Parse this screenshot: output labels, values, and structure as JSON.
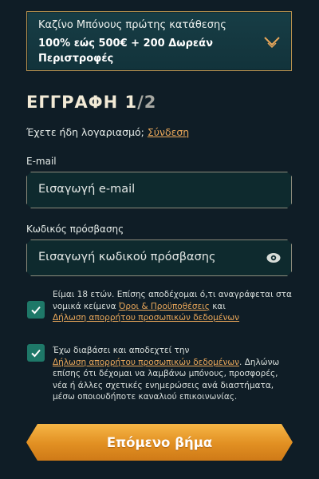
{
  "bonus": {
    "subtitle": "Καζίνο Μπόνους πρώτης κατάθεσης",
    "offer": "100% εώς 500€ + 200 Δωρεάν Περιστροφές",
    "chevron_icon": "chevron-down-icon"
  },
  "heading": {
    "title": "ΕΓΓΡΑΦΗ",
    "step_current": "1",
    "step_total": "/2"
  },
  "login": {
    "question": "Έχετε ήδη λογαριασμό;",
    "link": "Σύνδεση"
  },
  "email": {
    "label": "E-mail",
    "placeholder": "Εισαγωγή e-mail"
  },
  "password": {
    "label": "Κωδικός πρόσβασης",
    "placeholder": "Εισαγωγή κωδικού πρόσβασης",
    "eye_icon": "eye-icon"
  },
  "consent_age": {
    "checked": true,
    "text_1": "Είμαι 18 ετών. Επίσης αποδέχομαι ό,τι αναγράφεται στα νομικά κείμενα ",
    "link_terms": "Όροι & Προϋποθέσεις",
    "text_2": " και ",
    "link_privacy": "Δήλωση απορρήτου προσωπικών δεδομένων"
  },
  "consent_marketing": {
    "checked": true,
    "text_1": "Έχω διαβάσει και αποδεχτεί την ",
    "link_privacy": "Δήλωση απορρήτου προσωπικών δεδομένων",
    "text_2": ". Δηλώνω επίσης ότι δέχομαι να λαμβάνω μπόνους, προσφορές, νέα ή άλλες σχετικές ενημερώσεις ανά διαστήματα, μέσω οποιουδήποτε καναλιού επικοινωνίας."
  },
  "actions": {
    "next_label": "Επόμενο βήμα"
  },
  "colors": {
    "background": "#0f1d26",
    "accent_gold": "#b9924e",
    "link": "#e9a75a",
    "checkbox": "#1e7868",
    "button": "#e18f22"
  }
}
